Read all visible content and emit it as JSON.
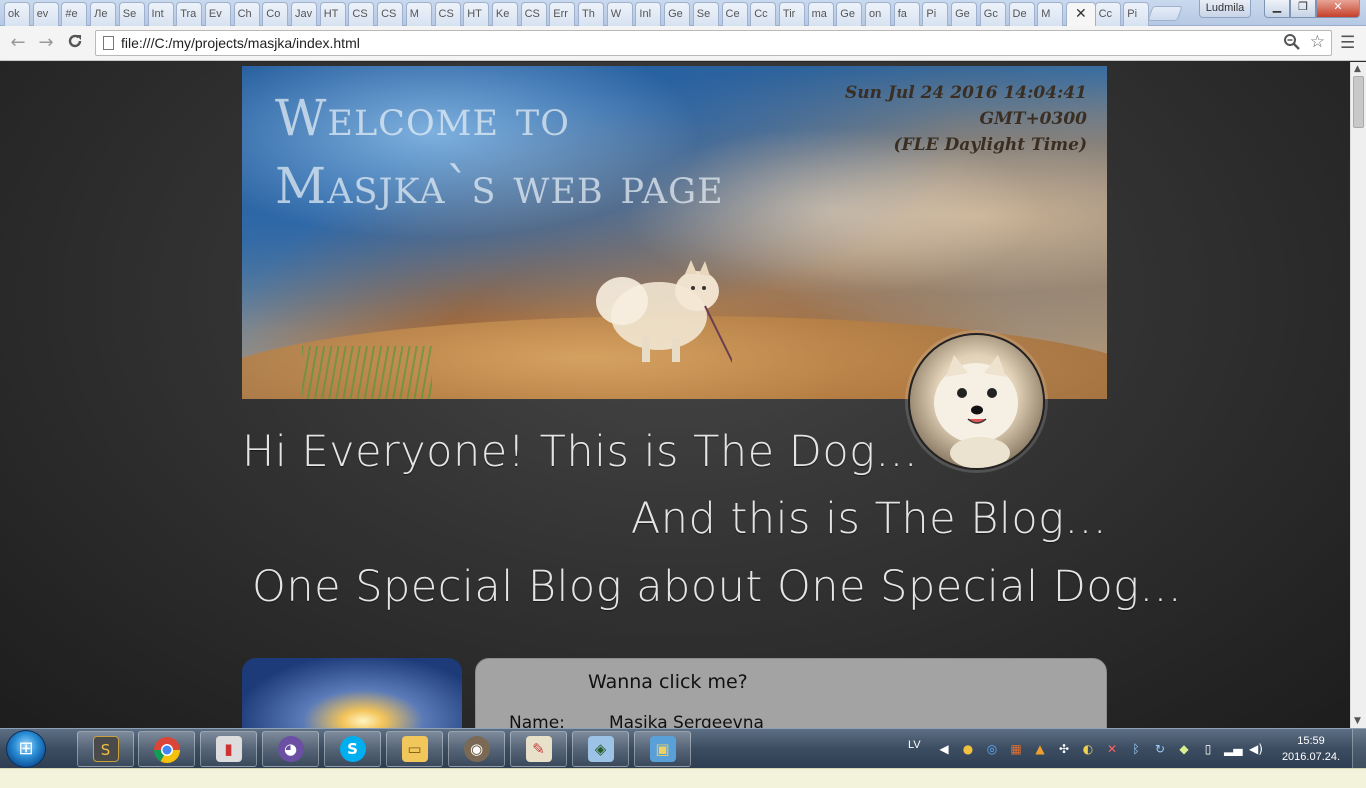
{
  "browser": {
    "tabs": [
      "ok",
      "ev",
      "#e",
      "Ле",
      "Se",
      "Int",
      "Tra",
      "Ev",
      "Ch",
      "Co",
      "Jav",
      "HT",
      "CS",
      "CS",
      "M",
      "CS",
      "HT",
      "Ke",
      "CS",
      "Err",
      "Th",
      "W",
      "Inl",
      "Ge",
      "Se",
      "Ce",
      "Cc",
      "Tir",
      "ma",
      "Ge",
      "on",
      "fa",
      "Pi",
      "Ge",
      "Gc",
      "De",
      "M",
      "✕",
      "Cc",
      "Pi"
    ],
    "user": "Ludmila",
    "window_buttons": {
      "minimize": "▁",
      "maximize": "❐",
      "close": "✕"
    },
    "nav": {
      "back": "←",
      "forward": "→",
      "reload": "C"
    },
    "url": "file:///C:/my/projects/masjka/index.html",
    "icons": {
      "zoom": "zoom-icon",
      "star": "star-icon",
      "menu": "menu-icon"
    }
  },
  "page": {
    "banner_title_line1": "Welcome to",
    "banner_title_line2": "Masjka`s web page",
    "banner_date_line1": "Sun Jul 24 2016 14:04:41 GMT+0300",
    "banner_date_line2": "(FLE Daylight Time)",
    "headline_1": "Hi Everyone! This is The Dog...",
    "headline_2": "And this is The Blog...",
    "headline_3": "One Special Blog about One Special Dog...",
    "click_card_title": "Wanna click me?",
    "click_name_label": "Name:",
    "click_name_value": "Masjka Sergeevna"
  },
  "taskbar": {
    "apps": [
      "sublime-text",
      "chrome",
      "usb-tool",
      "cat-app",
      "skype",
      "file-explorer",
      "gimp",
      "paint",
      "maps",
      "photos"
    ],
    "language": "LV",
    "clock_time": "15:59",
    "clock_date": "2016.07.24."
  },
  "colors": {
    "page_bg": "#2a2a2a",
    "headline": "#e4e4e4",
    "card_bg": "#a3a3a3",
    "taskbar": "#3c4d62"
  }
}
